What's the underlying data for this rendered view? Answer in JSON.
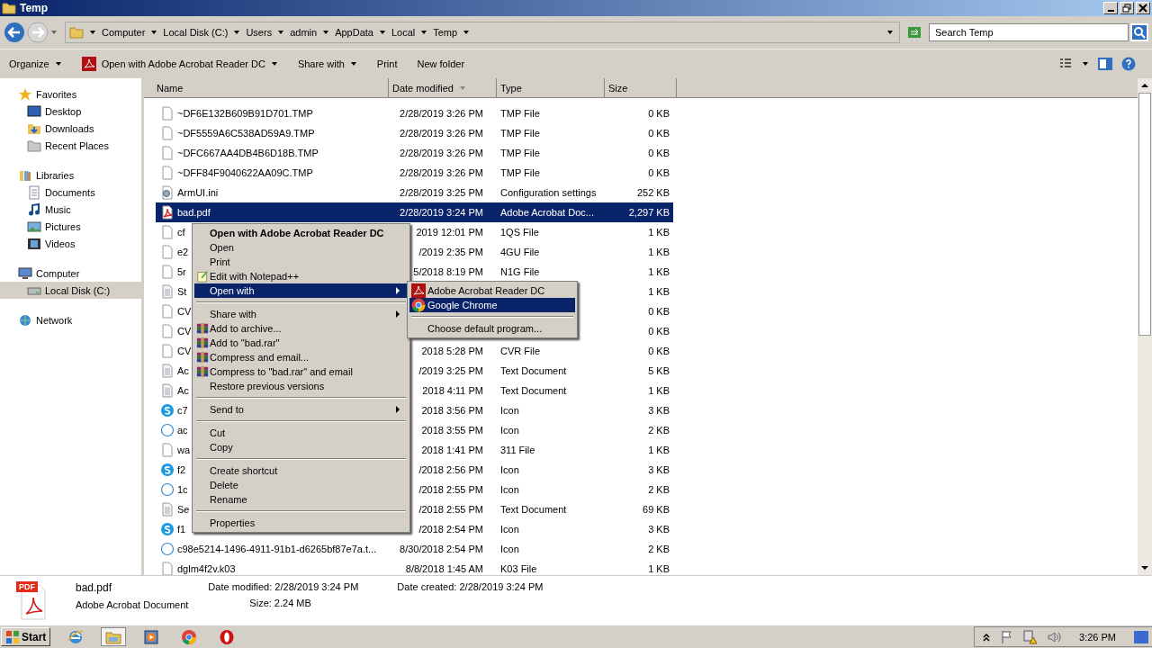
{
  "window": {
    "title": "Temp"
  },
  "breadcrumb": [
    "Computer",
    "Local Disk (C:)",
    "Users",
    "admin",
    "AppData",
    "Local",
    "Temp"
  ],
  "search": {
    "placeholder": "Search Temp"
  },
  "toolbar": [
    {
      "label": "Organize",
      "has_menu": true
    },
    {
      "label": "Open with Adobe Acrobat Reader DC",
      "has_menu": true,
      "kind": "acrobat"
    },
    {
      "label": "Share with",
      "has_menu": true
    },
    {
      "label": "Print",
      "has_menu": false
    },
    {
      "label": "New folder",
      "has_menu": false
    }
  ],
  "sidebar": [
    {
      "label": "Favorites",
      "kind": "star",
      "items": [
        {
          "label": "Desktop",
          "kind": "desktop",
          "selected": false
        },
        {
          "label": "Downloads",
          "kind": "folder",
          "selected": false
        },
        {
          "label": "Recent Places",
          "kind": "recent",
          "selected": false
        }
      ]
    },
    {
      "label": "Libraries",
      "kind": "library",
      "items": [
        {
          "label": "Documents",
          "kind": "doc",
          "selected": false
        },
        {
          "label": "Music",
          "kind": "music",
          "selected": false
        },
        {
          "label": "Pictures",
          "kind": "pictures",
          "selected": false
        },
        {
          "label": "Videos",
          "kind": "videos",
          "selected": false
        }
      ]
    },
    {
      "label": "Computer",
      "kind": "computer",
      "items": [
        {
          "label": "Local Disk (C:)",
          "kind": "disk",
          "selected": true
        }
      ]
    },
    {
      "label": "Network",
      "kind": "network"
    }
  ],
  "table": {
    "columns": [
      {
        "label": "Name",
        "sorted": false
      },
      {
        "label": "Date modified",
        "sorted": true
      },
      {
        "label": "Type",
        "sorted": false
      },
      {
        "label": "Size",
        "sorted": false
      }
    ],
    "rows": [
      {
        "name": "~DF6E132B609B91D701.TMP",
        "date": "2/28/2019 3:26 PM",
        "type": "TMP File",
        "size": "0 KB",
        "kind": "blank",
        "selected": false
      },
      {
        "name": "~DF5559A6C538AD59A9.TMP",
        "date": "2/28/2019 3:26 PM",
        "type": "TMP File",
        "size": "0 KB",
        "kind": "blank",
        "selected": false
      },
      {
        "name": "~DFC667AA4DB4B6D18B.TMP",
        "date": "2/28/2019 3:26 PM",
        "type": "TMP File",
        "size": "0 KB",
        "kind": "blank",
        "selected": false
      },
      {
        "name": "~DFF84F9040622AA09C.TMP",
        "date": "2/28/2019 3:26 PM",
        "type": "TMP File",
        "size": "0 KB",
        "kind": "blank",
        "selected": false
      },
      {
        "name": "ArmUI.ini",
        "date": "2/28/2019 3:25 PM",
        "type": "Configuration settings",
        "size": "252 KB",
        "kind": "ini",
        "selected": false
      },
      {
        "name": "bad.pdf",
        "date": "2/28/2019 3:24 PM",
        "type": "Adobe Acrobat Doc...",
        "size": "2,297 KB",
        "kind": "pdf",
        "selected": true
      },
      {
        "name": "cf",
        "date": "2019 12:01 PM",
        "type": "1QS File",
        "size": "1 KB",
        "kind": "blank",
        "selected": false
      },
      {
        "name": "e2",
        "date": "/2019 2:35 PM",
        "type": "4GU File",
        "size": "1 KB",
        "kind": "blank",
        "selected": false
      },
      {
        "name": "5r",
        "date": "5/2018 8:19 PM",
        "type": "N1G File",
        "size": "1 KB",
        "kind": "blank",
        "selected": false
      },
      {
        "name": "St",
        "size": "1 KB",
        "kind": "text",
        "selected": false
      },
      {
        "name": "CV",
        "size": "0 KB",
        "kind": "blank",
        "selected": false
      },
      {
        "name": "CV",
        "size": "0 KB",
        "kind": "blank",
        "selected": false
      },
      {
        "name": "CV",
        "date": "2018 5:28 PM",
        "type": "CVR File",
        "size": "0 KB",
        "kind": "blank",
        "selected": false
      },
      {
        "name": "Ac",
        "date": "/2019 3:25 PM",
        "type": "Text Document",
        "size": "5 KB",
        "kind": "text",
        "selected": false
      },
      {
        "name": "Ac",
        "date": "2018 4:11 PM",
        "type": "Text Document",
        "size": "1 KB",
        "kind": "text",
        "selected": false
      },
      {
        "name": "c7",
        "date": "2018 3:56 PM",
        "type": "Icon",
        "size": "3 KB",
        "kind": "skype",
        "selected": false
      },
      {
        "name": "ac",
        "date": "2018 3:55 PM",
        "type": "Icon",
        "size": "2 KB",
        "kind": "ring",
        "selected": false
      },
      {
        "name": "wa",
        "date": "2018 1:41 PM",
        "type": "311 File",
        "size": "1 KB",
        "kind": "blank",
        "selected": false
      },
      {
        "name": "f2",
        "date": "/2018 2:56 PM",
        "type": "Icon",
        "size": "3 KB",
        "kind": "skype",
        "selected": false
      },
      {
        "name": "1c",
        "date": "/2018 2:55 PM",
        "type": "Icon",
        "size": "2 KB",
        "kind": "ring",
        "selected": false
      },
      {
        "name": "Se",
        "date": "/2018 2:55 PM",
        "type": "Text Document",
        "size": "69 KB",
        "kind": "text",
        "selected": false
      },
      {
        "name": "f1",
        "date": "/2018 2:54 PM",
        "type": "Icon",
        "size": "3 KB",
        "kind": "skype",
        "selected": false
      },
      {
        "name": "c98e5214-1496-4911-91b1-d6265bf87e7a.t...",
        "date": "8/30/2018 2:54 PM",
        "type": "Icon",
        "size": "2 KB",
        "kind": "ring",
        "selected": false
      },
      {
        "name": "dglm4f2v.k03",
        "date": "8/8/2018 1:45 AM",
        "type": "K03 File",
        "size": "1 KB",
        "kind": "blank",
        "selected": false
      }
    ]
  },
  "context_menu": [
    {
      "label": "Open with Adobe Acrobat Reader DC",
      "kind": "default",
      "selected": false
    },
    {
      "label": "Open",
      "kind": "plain",
      "selected": false
    },
    {
      "label": "Print",
      "kind": "plain",
      "selected": false
    },
    {
      "label": "Edit with Notepad++",
      "kind": "notepad",
      "selected": false
    },
    {
      "label": "Open with",
      "kind": "submenu",
      "selected": true
    },
    {
      "kind": "separator"
    },
    {
      "label": "Share with",
      "kind": "submenu",
      "selected": false
    },
    {
      "label": "Add to archive...",
      "kind": "archive",
      "selected": false
    },
    {
      "label": "Add to \"bad.rar\"",
      "kind": "archive",
      "selected": false
    },
    {
      "label": "Compress and email...",
      "kind": "archive",
      "selected": false
    },
    {
      "label": "Compress to \"bad.rar\" and email",
      "kind": "archive",
      "selected": false
    },
    {
      "label": "Restore previous versions",
      "kind": "plain",
      "selected": false
    },
    {
      "kind": "separator"
    },
    {
      "label": "Send to",
      "kind": "submenu",
      "selected": false
    },
    {
      "kind": "separator"
    },
    {
      "label": "Cut",
      "kind": "plain",
      "selected": false
    },
    {
      "label": "Copy",
      "kind": "plain",
      "selected": false
    },
    {
      "kind": "separator"
    },
    {
      "label": "Create shortcut",
      "kind": "plain",
      "selected": false
    },
    {
      "label": "Delete",
      "kind": "plain",
      "selected": false
    },
    {
      "label": "Rename",
      "kind": "plain",
      "selected": false
    },
    {
      "kind": "separator"
    },
    {
      "label": "Properties",
      "kind": "plain",
      "selected": false
    }
  ],
  "submenu": [
    {
      "label": "Adobe Acrobat Reader DC",
      "kind": "acrobat",
      "selected": false
    },
    {
      "label": "Google Chrome",
      "kind": "chrome",
      "selected": true
    },
    {
      "kind": "separator"
    },
    {
      "label": "Choose default program...",
      "kind": "plain",
      "selected": false
    }
  ],
  "details": {
    "name": "bad.pdf",
    "type": "Adobe Acrobat Document",
    "fields": [
      {
        "label": "Date modified:",
        "value": "2/28/2019 3:24 PM"
      },
      {
        "label": "Size:",
        "value": "2.24 MB"
      },
      {
        "label": "Date created:",
        "value": "2/28/2019 3:24 PM"
      }
    ],
    "badge": "PDF"
  },
  "taskbar": {
    "start": "Start",
    "apps": [
      {
        "kind": "ie",
        "selected": false
      },
      {
        "kind": "explorer",
        "selected": true
      },
      {
        "kind": "media",
        "selected": false
      },
      {
        "kind": "chrome",
        "selected": false
      },
      {
        "kind": "opera",
        "selected": false
      }
    ],
    "clock": "3:26 PM"
  }
}
